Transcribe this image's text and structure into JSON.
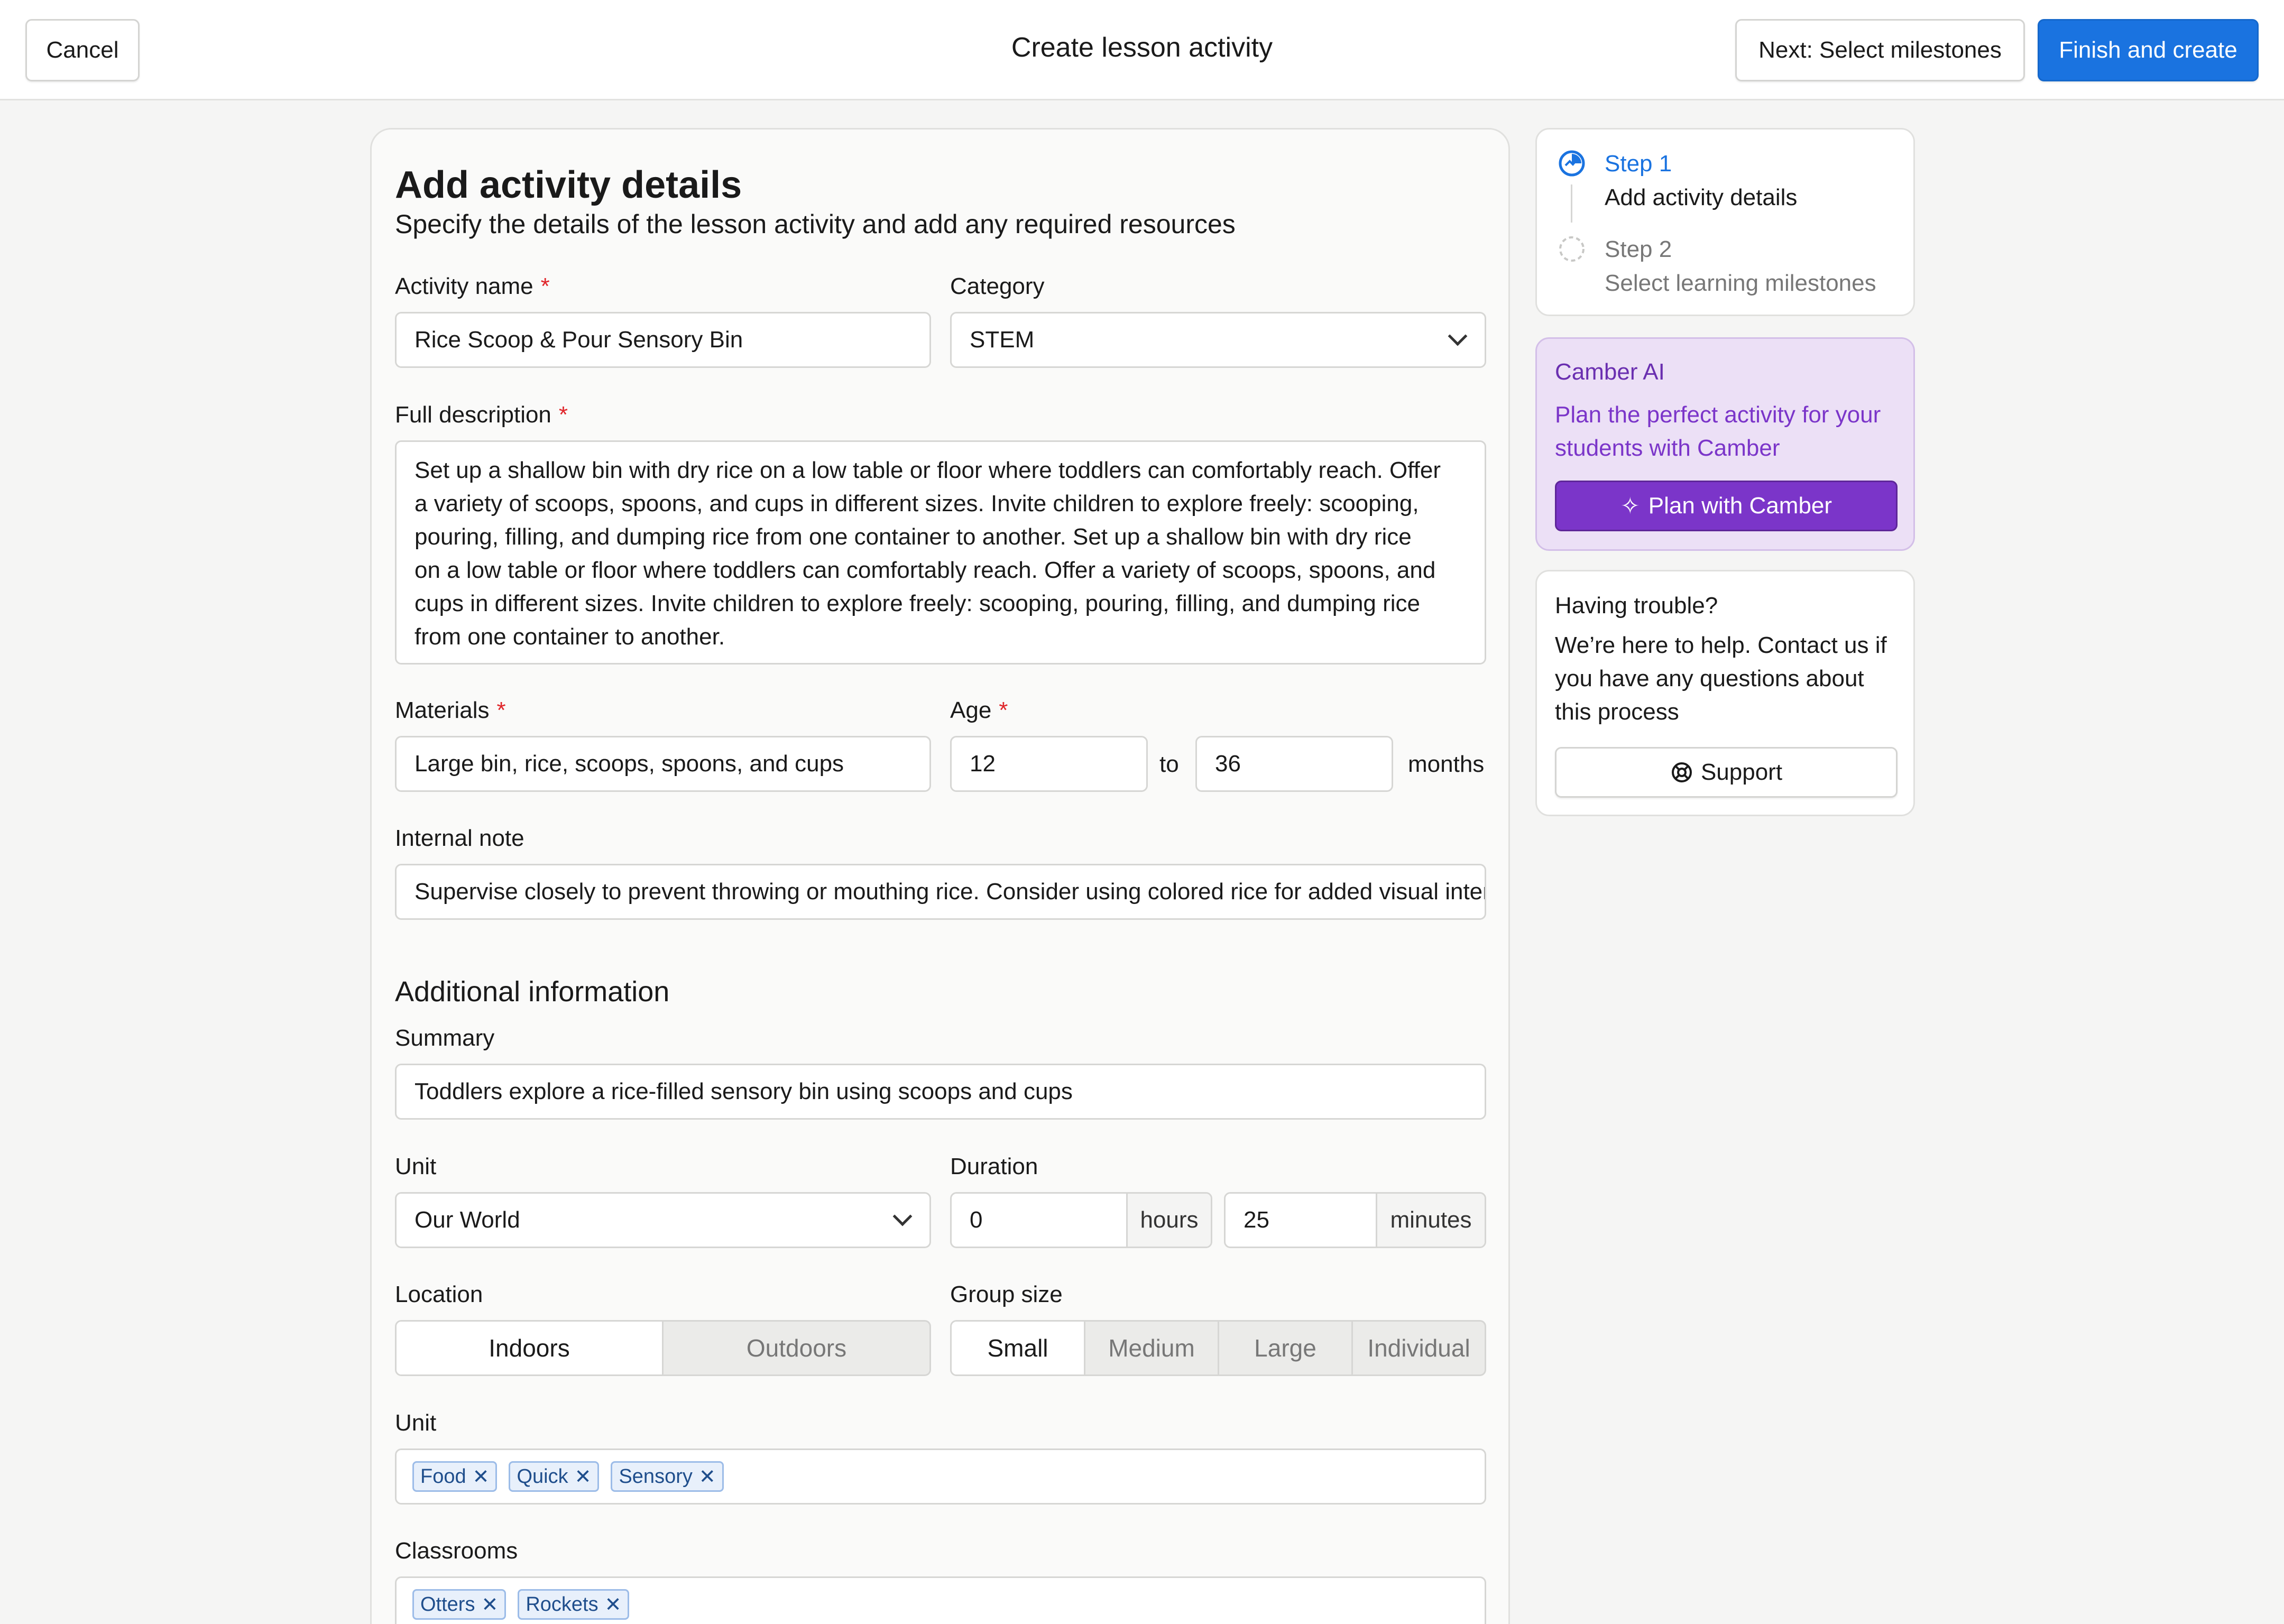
{
  "topbar": {
    "cancel_label": "Cancel",
    "title": "Create lesson activity",
    "next_label": "Next: Select milestones",
    "finish_label": "Finish and create"
  },
  "form": {
    "heading": "Add activity details",
    "subheading": "Specify the details of the lesson activity and add any required resources",
    "activity_name": {
      "label": "Activity name",
      "required": "*",
      "value": "Rice Scoop & Pour Sensory Bin"
    },
    "category": {
      "label": "Category",
      "value": "STEM"
    },
    "description": {
      "label": "Full description",
      "required": "*",
      "lines": [
        "Set up a shallow bin with dry rice on a low table or floor where toddlers can comfortably reach. Offer",
        "a variety of scoops, spoons, and cups in different sizes. Invite children to explore freely: scooping,",
        "pouring, filling, and dumping rice from one container to another.  Set up a shallow bin with dry rice",
        "on a low table or floor where toddlers can comfortably reach. Offer a variety of scoops, spoons, and",
        "cups in different sizes. Invite children to explore freely: scooping, pouring, filling, and dumping rice",
        "from one container to another."
      ]
    },
    "materials": {
      "label": "Materials",
      "required": "*",
      "value": "Large bin, rice, scoops, spoons, and cups"
    },
    "age": {
      "label": "Age",
      "required": "*",
      "from": "12",
      "to_label": "to",
      "to": "36",
      "unit": "months"
    },
    "internal_note": {
      "label": "Internal note",
      "value": "Supervise closely to prevent throwing or mouthing rice. Consider using colored rice for added visual interest."
    },
    "additional_heading": "Additional information",
    "summary": {
      "label": "Summary",
      "value": "Toddlers explore a rice-filled sensory bin using scoops and cups"
    },
    "unit": {
      "label": "Unit",
      "value": "Our World"
    },
    "duration": {
      "label": "Duration",
      "hours": "0",
      "hours_label": "hours",
      "minutes": "25",
      "minutes_label": "minutes"
    },
    "location": {
      "label": "Location",
      "options": [
        "Indoors",
        "Outdoors"
      ],
      "selected": "Indoors"
    },
    "group_size": {
      "label": "Group size",
      "options": [
        "Small",
        "Medium",
        "Large",
        "Individual"
      ],
      "selected": "Small"
    },
    "tags": {
      "label": "Unit",
      "items": [
        "Food",
        "Quick",
        "Sensory"
      ]
    },
    "classrooms": {
      "label": "Classrooms",
      "items": [
        "Otters",
        "Rockets"
      ]
    }
  },
  "steps": {
    "step1_label": "Step 1",
    "step1_title": "Add activity details",
    "step2_label": "Step 2",
    "step2_title": "Select learning milestones",
    "active_color": "#1a73e0"
  },
  "ai": {
    "title": "Camber AI",
    "line1": "Plan the perfect activity for your",
    "line2": "students with Camber",
    "button_label": "Plan with Camber",
    "color": "#7b35c9"
  },
  "help": {
    "title": "Having trouble?",
    "line1": "We’re here to help. Contact us if",
    "line2": "you have any questions about",
    "line3": "this process",
    "button_label": "Support"
  }
}
